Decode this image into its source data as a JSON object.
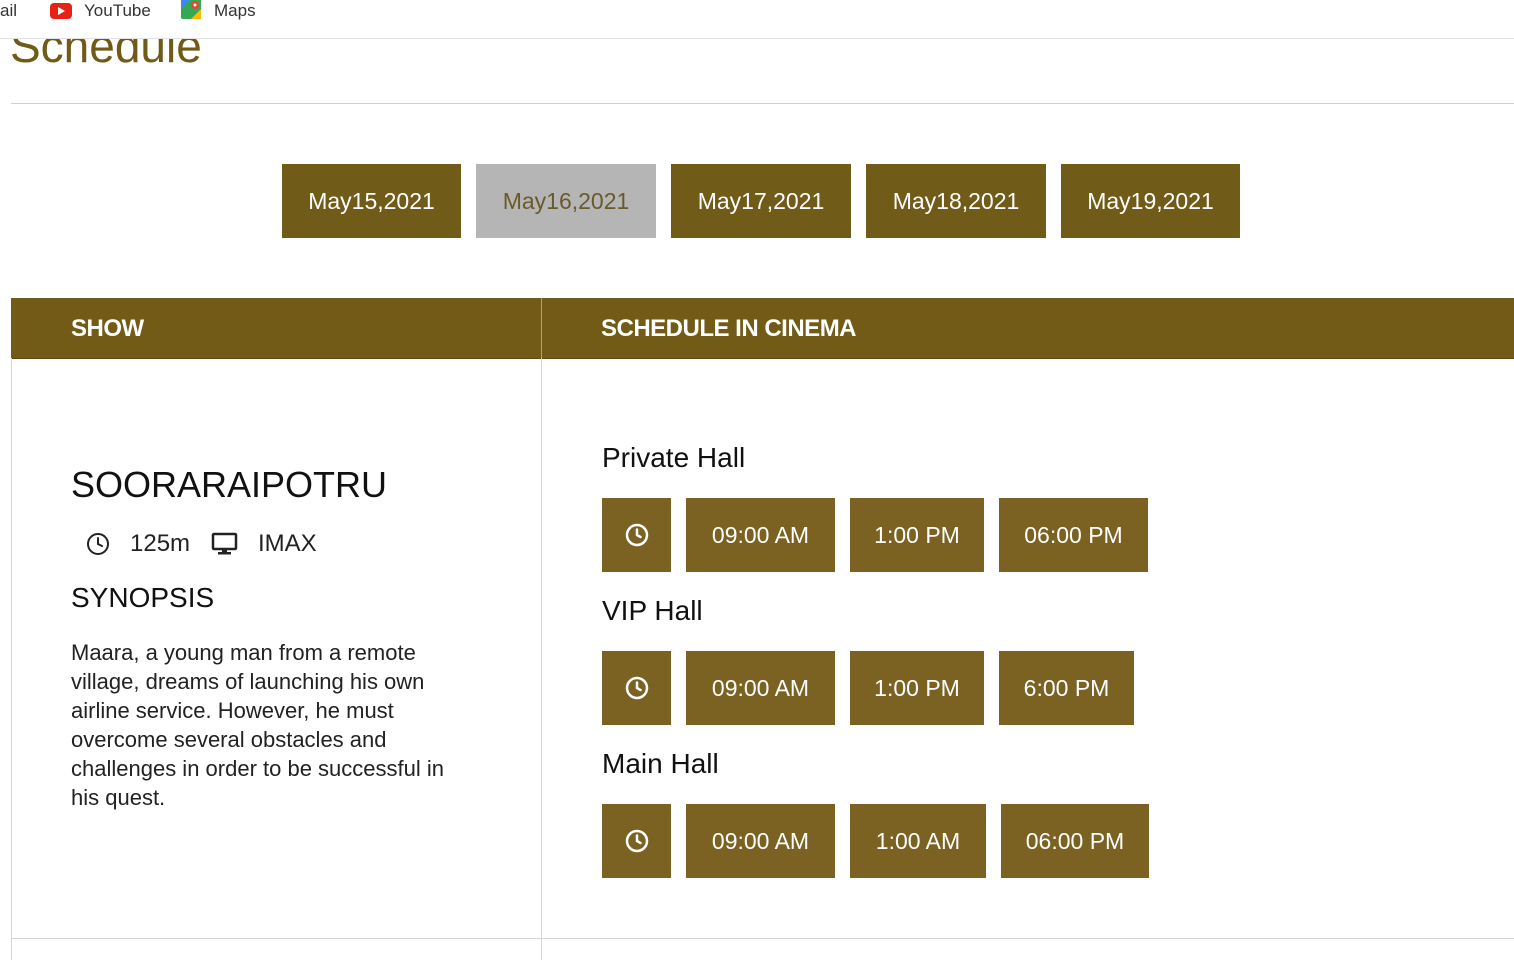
{
  "bookmarks": [
    {
      "label": "ail",
      "icon": "gmail-icon"
    },
    {
      "label": "YouTube",
      "icon": "youtube-icon"
    },
    {
      "label": "Maps",
      "icon": "maps-icon"
    }
  ],
  "page": {
    "title": "Schedule"
  },
  "dates": [
    "May15,2021",
    "May16,2021",
    "May17,2021",
    "May18,2021",
    "May19,2021"
  ],
  "active_date": "May16,2021",
  "table": {
    "headers": {
      "show": "SHOW",
      "schedule": "SCHEDULE IN CINEMA"
    }
  },
  "movie": {
    "title": "SOORARAIPOTRU",
    "duration": "125m",
    "format": "IMAX",
    "synopsis_heading": "SYNOPSIS",
    "synopsis": "Maara, a young man from a remote village, dreams of launching his own airline service. However, he must overcome several obstacles and challenges in order to be successful in his quest."
  },
  "halls": [
    {
      "name": "Private Hall",
      "times": [
        "09:00 AM",
        "1:00 PM",
        "06:00 PM"
      ]
    },
    {
      "name": "VIP Hall",
      "times": [
        "09:00 AM",
        "1:00 PM",
        "6:00 PM"
      ]
    },
    {
      "name": "Main Hall",
      "times": [
        "09:00 AM",
        "1:00 AM",
        "06:00 PM"
      ]
    }
  ],
  "colors": {
    "accent": "#715b16",
    "time_button": "#7b6222",
    "active_tab": "#b5b5b5",
    "title": "#6f5a16"
  }
}
